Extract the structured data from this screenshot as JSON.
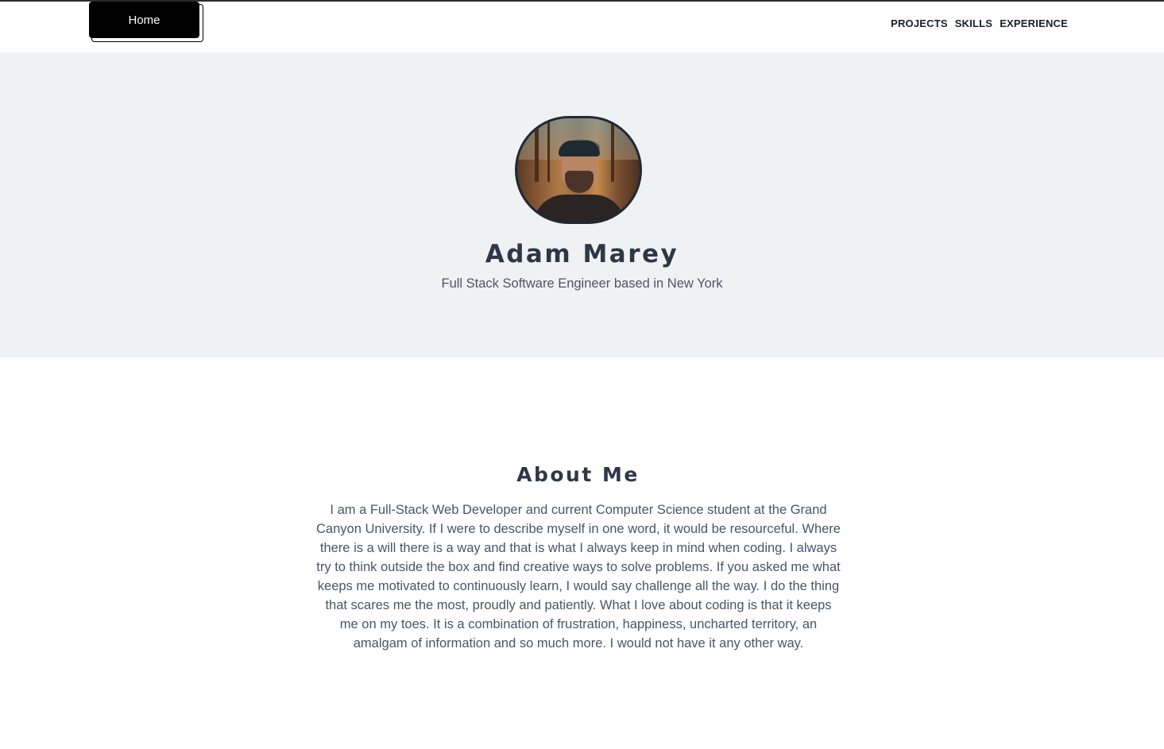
{
  "nav": {
    "home_label": "Home",
    "links": [
      "PROJECTS",
      "SKILLS",
      "EXPERIENCE"
    ]
  },
  "hero": {
    "name": "Adam Marey",
    "tagline": "Full Stack Software Engineer based in New York",
    "avatar_icon": "profile-photo"
  },
  "about": {
    "title": "About Me",
    "text": "I am a Full-Stack Web Developer and current Computer Science student at the Grand Canyon University. If I were to describe myself in one word, it would be resourceful. Where there is a will there is a way and that is what I always keep in mind when coding. I always try to think outside the box and find creative ways to solve problems. If you asked me what keeps me motivated to continuously learn, I would say challenge all the way. I do the thing that scares me the most, proudly and patiently. What I love about coding is that it keeps me on my toes. It is a combination of frustration, happiness, uncharted territory, an amalgam of information and so much more. I would not have it any other way."
  },
  "colors": {
    "hero_bg": "#f0f1f3",
    "heading": "#2d3748",
    "body_text": "#4a5568",
    "button_bg": "#000000"
  }
}
